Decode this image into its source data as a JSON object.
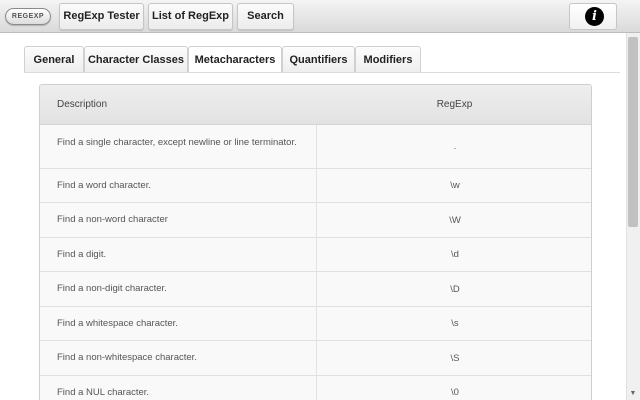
{
  "topbar": {
    "logo_text": "REGEXP",
    "nav": [
      {
        "label": "RegExp Tester"
      },
      {
        "label": "List of RegExp"
      },
      {
        "label": "Search"
      }
    ],
    "info_glyph": "i"
  },
  "tabs": [
    {
      "label": "General",
      "active": false
    },
    {
      "label": "Character Classes",
      "active": false
    },
    {
      "label": "Metacharacters",
      "active": true
    },
    {
      "label": "Quantifiers",
      "active": false
    },
    {
      "label": "Modifiers",
      "active": false
    }
  ],
  "table": {
    "headers": {
      "description": "Description",
      "regexp": "RegExp"
    },
    "rows": [
      {
        "description": "Find a single character, except newline or line terminator.",
        "regexp": "."
      },
      {
        "description": "Find a word character.",
        "regexp": "\\w"
      },
      {
        "description": "Find a non-word character",
        "regexp": "\\W"
      },
      {
        "description": "Find a digit.",
        "regexp": "\\d"
      },
      {
        "description": "Find a non-digit character.",
        "regexp": "\\D"
      },
      {
        "description": "Find a whitespace character.",
        "regexp": "\\s"
      },
      {
        "description": "Find a non-whitespace character.",
        "regexp": "\\S"
      },
      {
        "description": "Find a NUL character.",
        "regexp": "\\0"
      }
    ]
  },
  "scrollbar": {
    "arrow_glyph": "▼"
  },
  "colors": {
    "accent_border": "#c6c6c6",
    "header_bg": "#e6e6e6",
    "info_icon": "#000000"
  }
}
